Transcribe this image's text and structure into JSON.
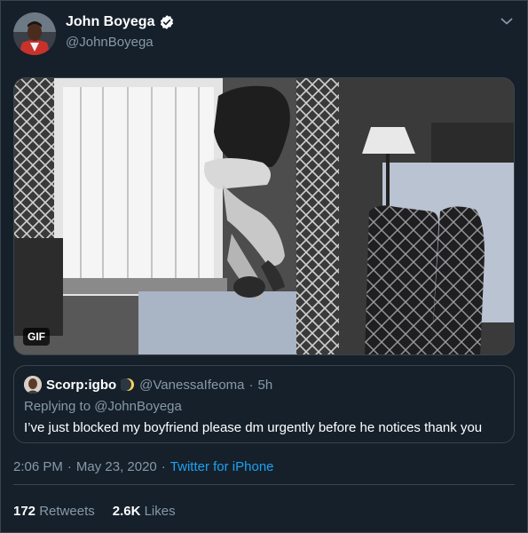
{
  "author": {
    "display_name": "John Boyega",
    "handle": "@JohnBoyega",
    "verified": true
  },
  "media": {
    "badge": "GIF"
  },
  "quoted_tweet": {
    "display_name": "Scorp:igbo",
    "handle": "@VanessaIfeoma",
    "separator": "·",
    "time": "5h",
    "replying_to": "Replying to @JohnBoyega",
    "text": "I’ve just blocked my boyfriend please dm urgently before he notices thank you"
  },
  "meta": {
    "time": "2:06 PM",
    "separator1": "·",
    "date": "May 23, 2020",
    "separator2": "·",
    "source": "Twitter for iPhone"
  },
  "stats": {
    "retweets_count": "172",
    "retweets_label": "Retweets",
    "likes_count": "2.6K",
    "likes_label": "Likes"
  },
  "colors": {
    "background": "#15202b",
    "border": "#38444d",
    "secondary_text": "#8899a6",
    "link": "#1da1f2",
    "verified_badge": "#ffffff"
  },
  "icons": [
    "verified-badge-icon",
    "chevron-down-icon",
    "crescent-moon-emoji-icon"
  ]
}
